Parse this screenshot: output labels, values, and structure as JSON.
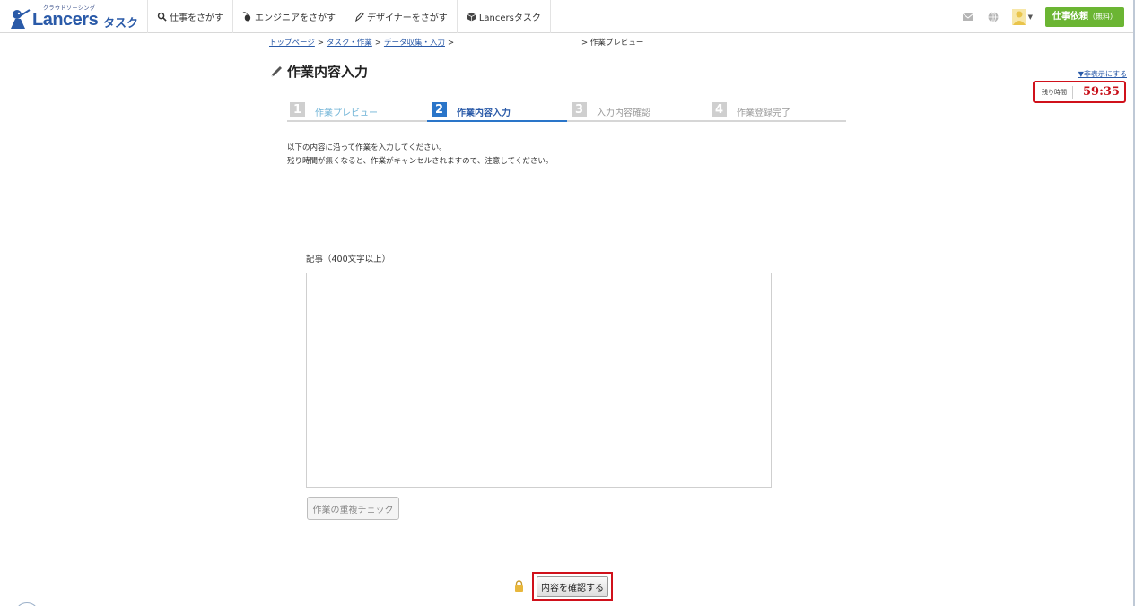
{
  "header": {
    "logo_sub": "クラウドソーシング",
    "logo_main": "Lancers",
    "logo_task": "タスク",
    "nav": [
      {
        "label": "仕事をさがす",
        "icon": "search-icon"
      },
      {
        "label": "エンジニアをさがす",
        "icon": "mouse-icon"
      },
      {
        "label": "デザイナーをさがす",
        "icon": "pen-icon"
      },
      {
        "label": "Lancersタスク",
        "icon": "box-icon"
      }
    ],
    "request_button": "仕事依頼",
    "request_button_note": "（無料）",
    "icons": [
      "mail-icon",
      "globe-icon",
      "avatar-icon",
      "caret-down-icon"
    ]
  },
  "breadcrumb": {
    "items": [
      "トップページ",
      "タスク・作業",
      "データ収集・入力"
    ],
    "separator": ">",
    "current": "> 作業プレビュー"
  },
  "page_title": "作業内容入力",
  "timer": {
    "hide_link": "▼非表示にする",
    "label": "残り時間",
    "value": "59:35"
  },
  "steps": [
    {
      "num": "1",
      "label": "作業プレビュー",
      "state": "done"
    },
    {
      "num": "2",
      "label": "作業内容入力",
      "state": "active"
    },
    {
      "num": "3",
      "label": "入力内容確認",
      "state": "todo"
    },
    {
      "num": "4",
      "label": "作業登録完了",
      "state": "todo"
    }
  ],
  "instructions": {
    "line1": "以下の内容に沿って作業を入力してください。",
    "line2": "残り時間が無くなると、作業がキャンセルされますので、注意してください。"
  },
  "form": {
    "article_label": "記事（400文字以上）",
    "article_value": "",
    "duplicate_check_button": "作業の重複チェック",
    "confirm_button": "内容を確認する"
  },
  "colors": {
    "brand_blue": "#2a5aa8",
    "active_step": "#2a75c9",
    "timer_red": "#c8101a",
    "request_green": "#6bb533"
  }
}
